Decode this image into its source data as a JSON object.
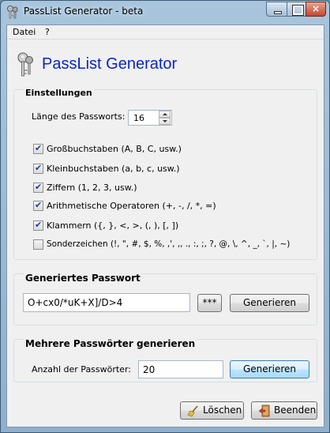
{
  "window": {
    "title": "PassList Generator - beta",
    "close_glyph": "×"
  },
  "menu": [
    {
      "label": "Datei"
    },
    {
      "label": "?"
    }
  ],
  "header": {
    "title": "PassList Generator",
    "icon": "keys-icon",
    "title_color": "#0b25c8"
  },
  "settings": {
    "title": "Einstellungen",
    "length_label": "Länge des Passworts:",
    "length_value": "16",
    "options": [
      {
        "label": "Großbuchstaben (A, B, C, usw.)",
        "checked": true
      },
      {
        "label": "Kleinbuchstaben (a, b, c, usw.)",
        "checked": true
      },
      {
        "label": "Ziffern (1, 2, 3, usw.)",
        "checked": true
      },
      {
        "label": "Arithmetische Operatoren (+, -, /, *, =)",
        "checked": true
      },
      {
        "label": "Klammern ({, }, <, >, (, ), [, ])",
        "checked": true
      },
      {
        "label": "Sonderzeichen (!, \", #, $, %, ,', ,, ., :, ;, ?, @, \\, ^, _, `, |, ~)",
        "checked": false
      }
    ]
  },
  "generated": {
    "title": "Generiertes Passwort",
    "password": "O+cx0/*uK+X]/D>4",
    "mask_button": "***",
    "generate_button": "Generieren"
  },
  "multiple": {
    "title": "Mehrere Passwörter generieren",
    "count_label": "Anzahl der Passwörter:",
    "count_value": "20",
    "generate_button": "Generieren"
  },
  "footer": {
    "clear_button": "Löschen",
    "exit_button": "Beenden"
  }
}
